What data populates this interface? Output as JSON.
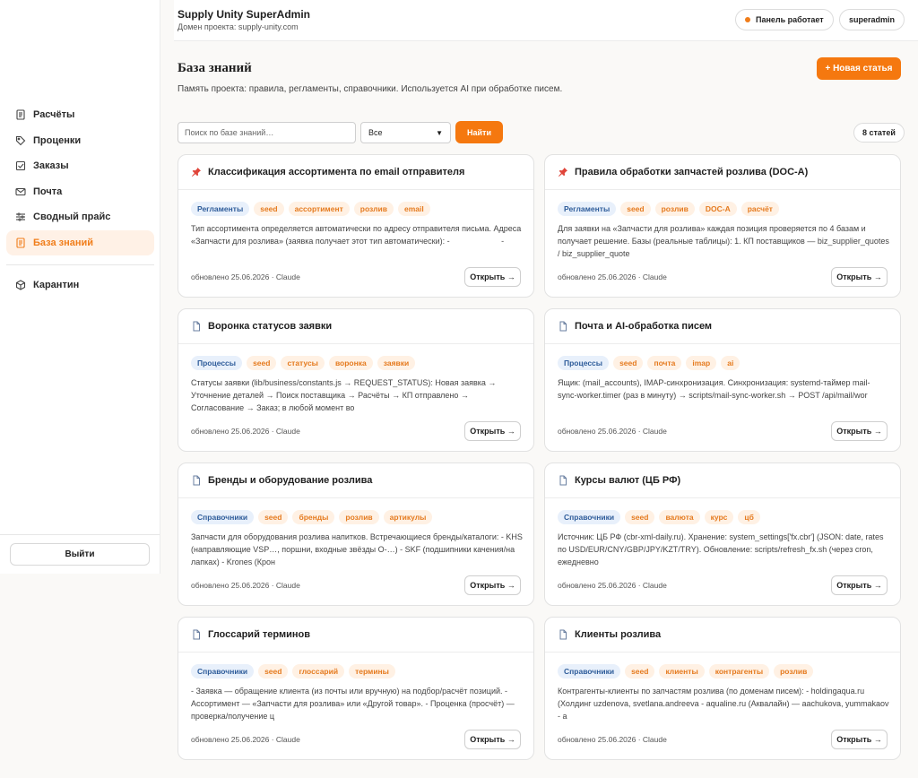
{
  "header": {
    "title": "Supply Unity SuperAdmin",
    "subtitle": "Домен проекта: supply-unity.com",
    "status": "Панель работает",
    "user": "superadmin"
  },
  "sidebar": {
    "items": [
      {
        "label": "Расчёты",
        "icon": "calculation-doc-icon"
      },
      {
        "label": "Проценки",
        "icon": "tag-icon"
      },
      {
        "label": "Заказы",
        "icon": "checkbox-icon"
      },
      {
        "label": "Почта",
        "icon": "mail-icon"
      },
      {
        "label": "Сводный прайс",
        "icon": "sliders-icon"
      },
      {
        "label": "База знаний",
        "icon": "knowledge-doc-icon",
        "active": true
      }
    ],
    "extra_items": [
      {
        "label": "Карантин",
        "icon": "box-icon"
      }
    ],
    "logout": "Выйти"
  },
  "page": {
    "title": "База знаний",
    "description": "Память проекта: правила, регламенты, справочники. Используется AI при обработке писем.",
    "new_button": "+ Новая статья",
    "search_placeholder": "Поиск по базе знаний…",
    "filter_value": "Все",
    "find_button": "Найти",
    "count": "8 статей"
  },
  "colors": {
    "accent": "#f5780f",
    "tag_bg": "#fff1e4",
    "category_bg": "#e8f0fb",
    "category_text": "#2e5c9a"
  },
  "cards": [
    {
      "icon": "pin-icon",
      "title": "Классификация ассортимента по email отправителя",
      "category": "Регламенты",
      "tags": [
        "seed",
        "ассортимент",
        "розлив",
        "email"
      ],
      "text": "Тип ассортимента определяется автоматически по адресу отправителя письма. Адреса «Запчасти для розлива» (заявка получает этот тип автоматически): - ‌ ‌ ‌ ‌ ‌ ‌ ‌ ‌ ‌ ‌ ‌ ‌ ‌ ‌ ‌ ‌ ‌ ‌ ‌ ‌ ‌ ‌ -",
      "meta": "обновлено 25.06.2026 · Claude",
      "open": "Открыть →"
    },
    {
      "icon": "pin-icon",
      "title": "Правила обработки запчастей розлива (DOC-A)",
      "category": "Регламенты",
      "tags": [
        "seed",
        "розлив",
        "DOC-A",
        "расчёт"
      ],
      "text": "Для заявки на «Запчасти для розлива» каждая позиция проверяется по 4 базам и получает решение. Базы (реальные таблицы): 1. КП поставщиков — biz_supplier_quotes / biz_supplier_quote",
      "meta": "обновлено 25.06.2026 · Claude",
      "open": "Открыть →"
    },
    {
      "icon": "document-icon",
      "title": "Воронка статусов заявки",
      "category": "Процессы",
      "tags": [
        "seed",
        "статусы",
        "воронка",
        "заявки"
      ],
      "text": "Статусы заявки (lib/business/constants.js → REQUEST_STATUS): Новая заявка → Уточнение деталей → Поиск поставщика → Расчёты → КП отправлено → Согласование → Заказ; в любой момент во",
      "meta": "обновлено 25.06.2026 · Claude",
      "open": "Открыть →"
    },
    {
      "icon": "document-icon",
      "title": "Почта и AI-обработка писем",
      "category": "Процессы",
      "tags": [
        "seed",
        "почта",
        "imap",
        "ai"
      ],
      "text": "Ящик: (mail_accounts), IMAP-синхронизация. Синхронизация: systemd-таймер mail-sync-worker.timer (раз в минуту) → scripts/mail-sync-worker.sh → POST /api/mail/wor",
      "meta": "обновлено 25.06.2026 · Claude",
      "open": "Открыть →"
    },
    {
      "icon": "document-icon",
      "title": "Бренды и оборудование розлива",
      "category": "Справочники",
      "tags": [
        "seed",
        "бренды",
        "розлив",
        "артикулы"
      ],
      "text": "Запчасти для оборудования розлива напитков. Встречающиеся бренды/каталоги: - KHS (направляющие VSP…, поршни, входные звёзды O-…) - SKF (подшипники качения/на лапках) - Krones (Крон",
      "meta": "обновлено 25.06.2026 · Claude",
      "open": "Открыть →"
    },
    {
      "icon": "document-icon",
      "title": "Курсы валют (ЦБ РФ)",
      "category": "Справочники",
      "tags": [
        "seed",
        "валюта",
        "курс",
        "цб"
      ],
      "text": "Источник: ЦБ РФ (cbr-xml-daily.ru). Хранение: system_settings['fx.cbr'] (JSON: date, rates по USD/EUR/CNY/GBP/JPY/KZT/TRY). Обновление: scripts/refresh_fx.sh (через cron, ежедневно",
      "meta": "обновлено 25.06.2026 · Claude",
      "open": "Открыть →"
    },
    {
      "icon": "document-icon",
      "title": "Глоссарий терминов",
      "category": "Справочники",
      "tags": [
        "seed",
        "глоссарий",
        "термины"
      ],
      "text": "- Заявка — обращение клиента (из почты или вручную) на подбор/расчёт позиций. - Ассортимент — «Запчасти для розлива» или «Другой товар». - Проценка (просчёт) — проверка/получение ц",
      "meta": "обновлено 25.06.2026 · Claude",
      "open": "Открыть →"
    },
    {
      "icon": "document-icon",
      "title": "Клиенты розлива",
      "category": "Справочники",
      "tags": [
        "seed",
        "клиенты",
        "контрагенты",
        "розлив"
      ],
      "text": "Контрагенты-клиенты по запчастям розлива (по доменам писем): - holdingaqua.ru (Холдинг uzdenova, svetlana.andreeva - aqualine.ru (Аквалайн) — aachukova, yummakaov - a",
      "meta": "обновлено 25.06.2026 · Claude",
      "open": "Открыть →"
    }
  ]
}
